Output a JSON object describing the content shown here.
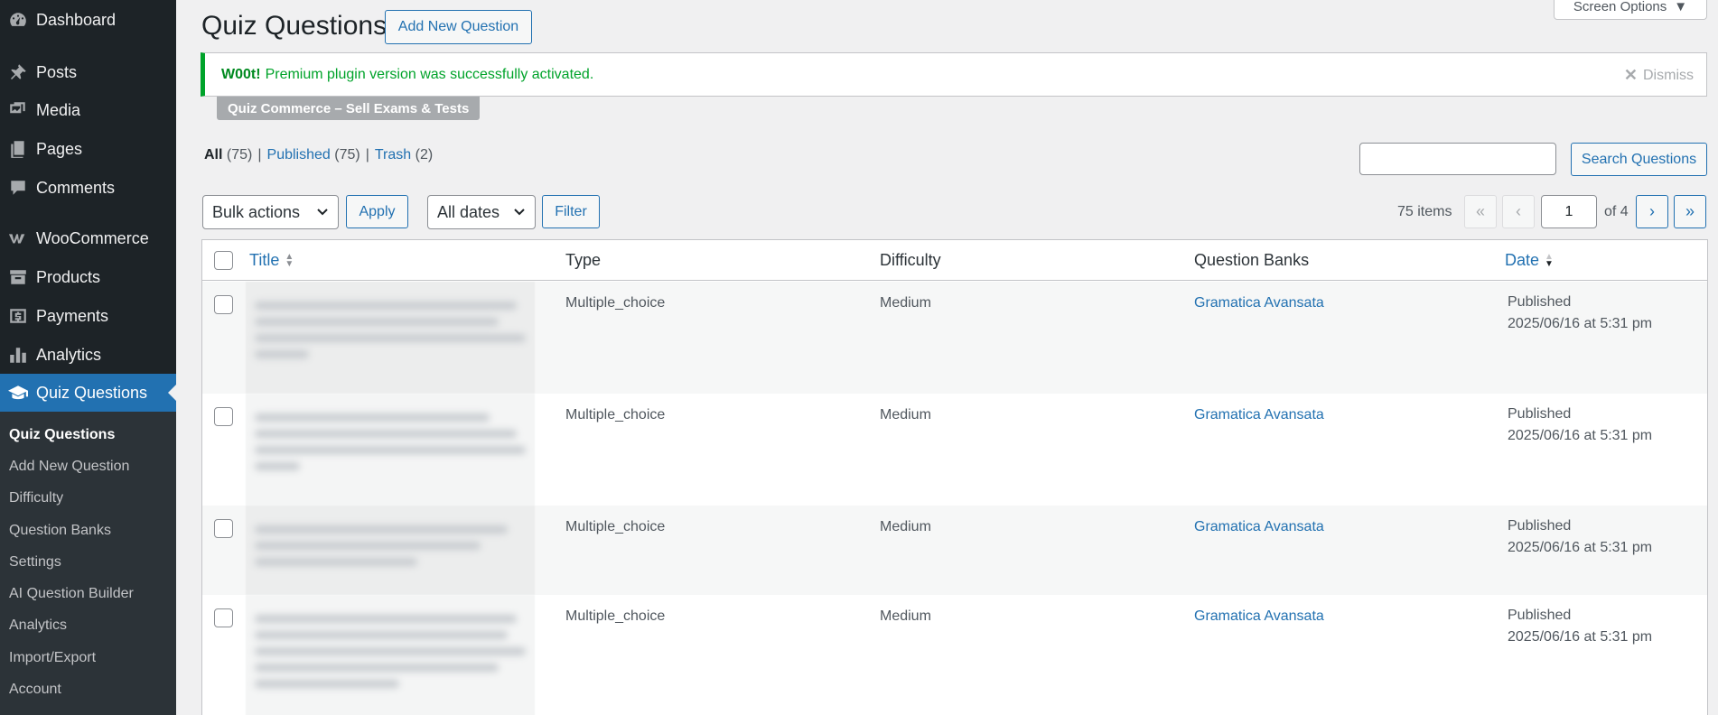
{
  "sidebar": {
    "items": [
      {
        "label": "Dashboard",
        "icon": "dashboard-icon"
      },
      {
        "label": "Posts",
        "icon": "pin-icon"
      },
      {
        "label": "Media",
        "icon": "media-icon"
      },
      {
        "label": "Pages",
        "icon": "pages-icon"
      },
      {
        "label": "Comments",
        "icon": "comment-icon"
      },
      {
        "label": "WooCommerce",
        "icon": "woocommerce-icon"
      },
      {
        "label": "Products",
        "icon": "archive-icon"
      },
      {
        "label": "Payments",
        "icon": "dollar-icon"
      },
      {
        "label": "Analytics",
        "icon": "bar-chart-icon"
      },
      {
        "label": "Quiz Questions",
        "icon": "graduation-cap-icon",
        "active": true
      }
    ],
    "submenu": [
      {
        "label": "Quiz Questions",
        "current": true
      },
      {
        "label": "Add New Question"
      },
      {
        "label": "Difficulty"
      },
      {
        "label": "Question Banks"
      },
      {
        "label": "Settings"
      },
      {
        "label": "AI Question Builder"
      },
      {
        "label": "Analytics"
      },
      {
        "label": "Import/Export"
      },
      {
        "label": "Account"
      }
    ]
  },
  "header": {
    "title": "Quiz Questions",
    "add_new_label": "Add New Question",
    "screen_options_label": "Screen Options"
  },
  "notice": {
    "strong": "W00t!",
    "message": "Premium plugin version was successfully activated.",
    "dismiss_label": "Dismiss",
    "plugin_badge": "Quiz Commerce – Sell Exams & Tests"
  },
  "views": {
    "all_label": "All",
    "all_count": "(75)",
    "published_label": "Published",
    "published_count": "(75)",
    "trash_label": "Trash",
    "trash_count": "(2)",
    "separator": "|"
  },
  "search": {
    "placeholder": "",
    "button_label": "Search Questions"
  },
  "toolbar": {
    "bulk_actions": "Bulk actions",
    "apply_label": "Apply",
    "dates_filter": "All dates",
    "filter_label": "Filter"
  },
  "pagination": {
    "items_text": "75 items",
    "first": "«",
    "prev": "‹",
    "next": "›",
    "last": "»",
    "current_page": "1",
    "of_text": "of 4"
  },
  "table": {
    "columns": {
      "title": "Title",
      "type": "Type",
      "difficulty": "Difficulty",
      "banks": "Question Banks",
      "date": "Date"
    },
    "rows": [
      {
        "type": "Multiple_choice",
        "difficulty": "Medium",
        "bank": "Gramatica Avansata",
        "status": "Published",
        "date": "2025/06/16 at 5:31 pm"
      },
      {
        "type": "Multiple_choice",
        "difficulty": "Medium",
        "bank": "Gramatica Avansata",
        "status": "Published",
        "date": "2025/06/16 at 5:31 pm"
      },
      {
        "type": "Multiple_choice",
        "difficulty": "Medium",
        "bank": "Gramatica Avansata",
        "status": "Published",
        "date": "2025/06/16 at 5:31 pm"
      },
      {
        "type": "Multiple_choice",
        "difficulty": "Medium",
        "bank": "Gramatica Avansata",
        "status": "Published",
        "date": "2025/06/16 at 5:31 pm"
      }
    ]
  },
  "colors": {
    "accent": "#2271b1",
    "sidebar": "#1d2327",
    "success": "#00a32a"
  }
}
